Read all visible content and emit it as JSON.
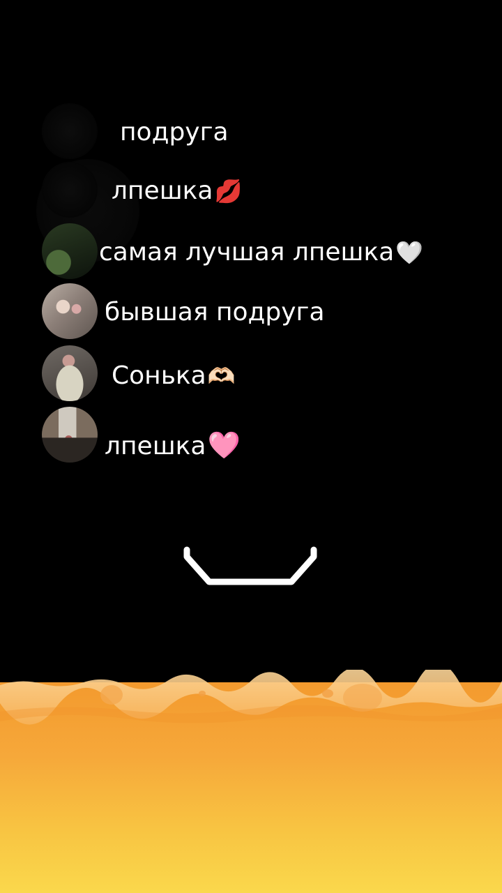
{
  "items": [
    {
      "label": "подруга",
      "emoji": "",
      "avatar": "dark"
    },
    {
      "label": "лпешка",
      "emoji": "💋",
      "avatar": "dark"
    },
    {
      "label": "самая лучшая лпешка",
      "emoji": "🤍",
      "avatar": "green"
    },
    {
      "label": "бывшая подруга",
      "emoji": "",
      "avatar": "mirror-selfie"
    },
    {
      "label": "Сонька",
      "emoji": "🫶🏻",
      "avatar": "pillow"
    },
    {
      "label": "лпешка",
      "emoji": "🩷",
      "avatar": "room"
    }
  ],
  "colors": {
    "background": "#000000",
    "text": "#ffffff",
    "lava_top": "#f6a13a",
    "lava_bottom": "#f9d24a",
    "claw": "#ffffff"
  },
  "icons": {
    "claw": "claw-grabber-icon",
    "lava": "lava-surface"
  }
}
